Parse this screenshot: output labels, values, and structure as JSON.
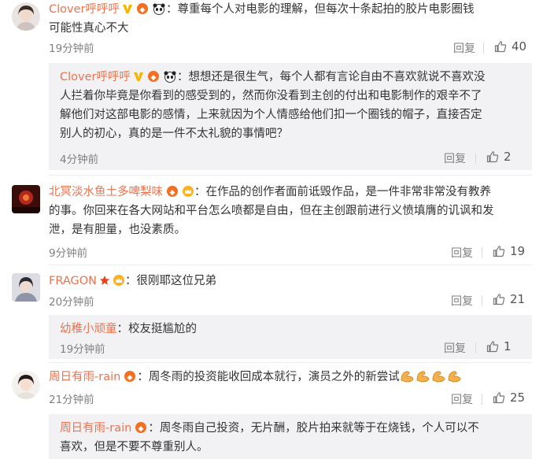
{
  "colors": {
    "username": "#eb7350",
    "meta": "#808080",
    "subbg": "#f2f2f5"
  },
  "icons": {
    "like": "thumb-up-icon",
    "verified": "yellow-v-icon",
    "panda": "panda-icon",
    "membership": "member-badge-icon",
    "crown": "crown-icon",
    "star": "star-icon",
    "flex": "flexed-bicep-emoji"
  },
  "comments": [
    {
      "user": "Clover呼呼呼",
      "text_line1": "尊重每个人对电影的理解，但每次十条起拍的胶片电影圈钱",
      "text_line2": "可能性真心不大",
      "time": "19分钟前",
      "reply": "回复",
      "likes": "40"
    },
    {
      "user": "Clover呼呼呼",
      "text_line1": "想想还是很生气，每个人都有言论自由不喜欢就说不喜欢没",
      "text_line2": "人拦着你毕竟是你看到的感受到的，然而你没看到主创的付出和电影制作的艰辛不了",
      "text_line3": "解他们对这部电影的感情，上来就因为个人情感给他们扣一个圈钱的帽子，直接否定",
      "text_line4": "别人的初心，真的是一件不太礼貌的事情吧？",
      "time": "4分钟前",
      "reply": "回复",
      "likes": "2"
    },
    {
      "user": "北冥淡水鱼土多啤梨味",
      "text_line1": "在作品的创作者面前诋毁作品，是一件非常非常没有教养",
      "text_line2": "的事。你回来在各大网站和平台怎么喷都是自由，但在主创跟前进行义愤填膺的讥讽和发",
      "text_line3": "泄，是有胆量，也没素质。",
      "time": "9分钟前",
      "reply": "回复",
      "likes": "19"
    },
    {
      "user": "FRAGON",
      "text_line1": "很刚耶这位兄弟",
      "time": "20分钟前",
      "reply": "回复",
      "likes": "21"
    },
    {
      "user": "幼稚小顽童",
      "text_line1": "校友挺尴尬的",
      "time": "19分钟前",
      "reply": "回复",
      "likes": "1"
    },
    {
      "user": "周日有雨-rain",
      "text_line1": "周冬雨的投资能收回成本就行，演员之外的新尝试",
      "time": "21分钟前",
      "reply": "回复",
      "likes": "25"
    },
    {
      "user": "周日有雨-rain",
      "text_line1": "周冬雨自己投资，无片酬，胶片拍来就等于在烧钱，个人可以不",
      "text_line2": "喜欢，但是不要不尊重别人。"
    }
  ]
}
